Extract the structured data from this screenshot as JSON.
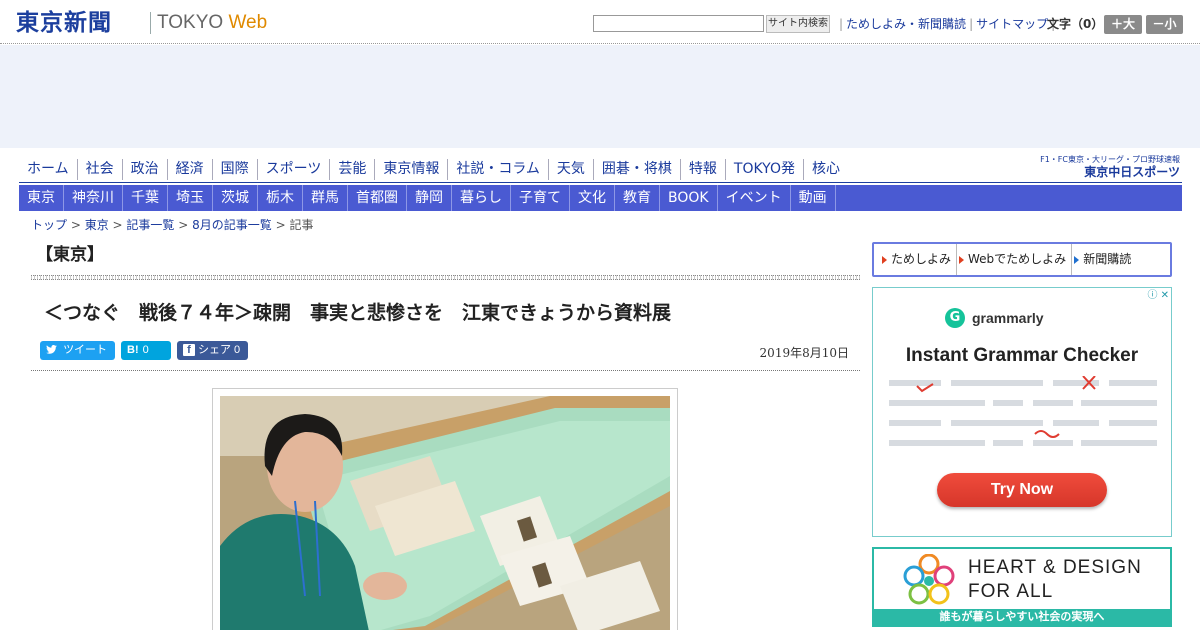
{
  "header": {
    "logo_jp": "東京新聞",
    "logo_en": "TOKYO ",
    "logo_web": "Web",
    "search_placeholder": "",
    "search_button": "サイト内検索",
    "links": [
      "ためしよみ・新聞購読",
      "サイトマップ"
    ],
    "fontsize_label": "文字（0）",
    "font_plus": "＋大",
    "font_minus": "－小"
  },
  "nav_main": [
    "ホーム",
    "社会",
    "政治",
    "経済",
    "国際",
    "スポーツ",
    "芸能",
    "東京情報",
    "社説・コラム",
    "天気",
    "囲碁・将棋",
    "特報",
    "TOKYO発",
    "核心"
  ],
  "chunichi": {
    "line1": "F1・FC東京・大リーグ・プロ野球速報",
    "line2": "東京中日スポーツ"
  },
  "nav_region": [
    "東京",
    "神奈川",
    "千葉",
    "埼玉",
    "茨城",
    "栃木",
    "群馬",
    "首都圏",
    "静岡",
    "暮らし",
    "子育て",
    "文化",
    "教育",
    "BOOK",
    "イベント",
    "動画"
  ],
  "breadcrumb": {
    "items": [
      "トップ",
      "東京",
      "記事一覧",
      "8月の記事一覧"
    ],
    "current": "記事"
  },
  "article": {
    "section": "【東京】",
    "headline": "＜つなぐ　戦後７４年＞疎開　事実と悲惨さを　江東できょうから資料展",
    "date": "2019年8月10日",
    "share_twitter": "ツイート",
    "share_twitter_icon": "twitter-bird-icon",
    "share_hatena": "0",
    "share_hatena_mark": "B!",
    "share_facebook": "シェア 0",
    "share_facebook_mark": "f"
  },
  "sidebar": {
    "links": [
      "ためしよみ",
      "Webでためしよみ",
      "新聞購読"
    ]
  },
  "ad_grammarly": {
    "brand": "grammarly",
    "brand_mark": "G",
    "headline": "Instant Grammar Checker",
    "button": "Try Now",
    "ad_choice": "ⓘ ✕",
    "accent": "#15c39a"
  },
  "ad_heart": {
    "line1": "HEART & DESIGN",
    "line2": "FOR ALL",
    "bar": "誰もが暮らしやすい社会の実現へ",
    "accent": "#2bb9a6"
  }
}
